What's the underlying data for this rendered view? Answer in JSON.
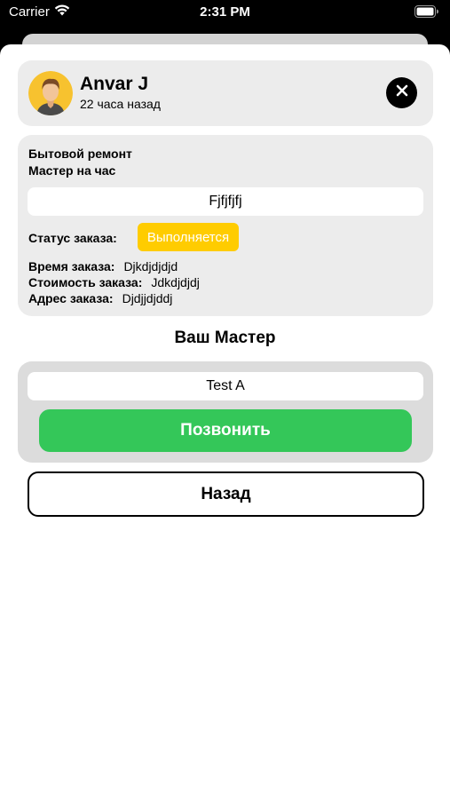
{
  "status_bar": {
    "carrier": "Carrier",
    "time": "2:31 PM",
    "wifi_icon": "wifi-icon",
    "battery_icon": "battery-icon"
  },
  "header": {
    "user_name": "Anvar J",
    "time_ago": "22 часа назад",
    "avatar_icon": "avatar",
    "close_icon": "close-icon"
  },
  "order": {
    "category": "Бытовой ремонт",
    "subcategory": "Мастер на час",
    "title": "Fjfjfjfj",
    "status_label": "Статус заказа:",
    "status_value": "Выполняется",
    "time_label": "Время заказа:",
    "time_value": "Djkdjdjdjd",
    "cost_label": "Стоимость заказа:",
    "cost_value": "Jdkdjdjdj",
    "address_label": "Адрес заказа:",
    "address_value": "Djdjjdjddj"
  },
  "master": {
    "heading": "Ваш Мастер",
    "name": "Test A",
    "call_label": "Позвонить"
  },
  "back_label": "Назад",
  "colors": {
    "status_badge": "#ffcc00",
    "call_button": "#34c759",
    "card_background": "#ececec",
    "master_card_background": "#dcdcdc"
  }
}
